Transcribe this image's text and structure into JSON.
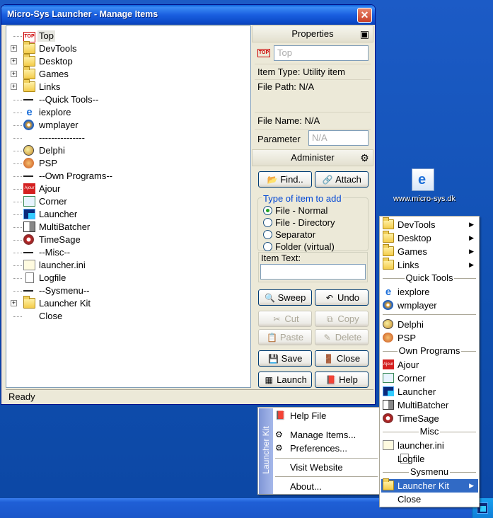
{
  "window": {
    "title": "Micro-Sys Launcher - Manage Items",
    "close_glyph": "✕",
    "status": "Ready"
  },
  "tree": [
    {
      "label": "Top",
      "icon": "top-icon",
      "expandable": false,
      "selected": true
    },
    {
      "label": "DevTools",
      "icon": "folder-icon",
      "expandable": true
    },
    {
      "label": "Desktop",
      "icon": "folder-icon",
      "expandable": true
    },
    {
      "label": "Games",
      "icon": "folder-icon",
      "expandable": true
    },
    {
      "label": "Links",
      "icon": "folder-icon",
      "expandable": true
    },
    {
      "label": "--Quick Tools--",
      "icon": "separator-icon",
      "expandable": false
    },
    {
      "label": "iexplore",
      "icon": "ie-icon",
      "expandable": false
    },
    {
      "label": "wmplayer",
      "icon": "wmplayer-icon",
      "expandable": false
    },
    {
      "label": "---------------",
      "icon": "none",
      "expandable": false
    },
    {
      "label": "Delphi",
      "icon": "delphi-icon",
      "expandable": false
    },
    {
      "label": "PSP",
      "icon": "psp-icon",
      "expandable": false
    },
    {
      "label": "--Own Programs--",
      "icon": "separator-icon",
      "expandable": false
    },
    {
      "label": "Ajour",
      "icon": "ajour-icon",
      "expandable": false
    },
    {
      "label": "Corner",
      "icon": "corner-icon",
      "expandable": false
    },
    {
      "label": "Launcher",
      "icon": "launcher-icon",
      "expandable": false
    },
    {
      "label": "MultiBatcher",
      "icon": "multibatcher-icon",
      "expandable": false
    },
    {
      "label": "TimeSage",
      "icon": "timesage-icon",
      "expandable": false
    },
    {
      "label": "--Misc--",
      "icon": "separator-icon",
      "expandable": false
    },
    {
      "label": "launcher.ini",
      "icon": "ini-file-icon",
      "expandable": false
    },
    {
      "label": "Logfile",
      "icon": "log-file-icon",
      "expandable": false
    },
    {
      "label": "--Sysmenu--",
      "icon": "separator-icon",
      "expandable": false
    },
    {
      "label": "Launcher Kit",
      "icon": "folder-icon",
      "expandable": true
    },
    {
      "label": "Close",
      "icon": "none",
      "expandable": false
    }
  ],
  "properties": {
    "header": "Properties",
    "top_icon_text": "TOP",
    "name_value": "Top",
    "item_type": "Item Type: Utility item",
    "file_path": "File Path: N/A",
    "file_name": "File Name: N/A",
    "parameter_label": "Parameter",
    "parameter_value": "N/A"
  },
  "administer": {
    "header": "Administer",
    "find": "Find..",
    "attach": "Attach",
    "group_label": "Type of item to add",
    "radios": [
      "File - Normal",
      "File - Directory",
      "Separator",
      "Folder (virtual)"
    ],
    "selected_radio": 0,
    "item_text_label": "Item Text:",
    "item_text_value": "",
    "sweep": "Sweep",
    "undo": "Undo",
    "cut": "Cut",
    "copy": "Copy",
    "paste": "Paste",
    "delete": "Delete",
    "save": "Save",
    "close": "Close",
    "launch": "Launch",
    "help": "Help"
  },
  "desktop_icon": {
    "label": "www.micro-sys.dk"
  },
  "context_menu": {
    "items": [
      {
        "label": "DevTools",
        "type": "folder"
      },
      {
        "label": "Desktop",
        "type": "folder"
      },
      {
        "label": "Games",
        "type": "folder"
      },
      {
        "label": "Links",
        "type": "folder"
      },
      {
        "label": "Quick Tools",
        "type": "sep"
      },
      {
        "label": "iexplore",
        "type": "item",
        "icon": "ie-icon"
      },
      {
        "label": "wmplayer",
        "type": "item",
        "icon": "wmplayer-icon"
      },
      {
        "label": "",
        "type": "line"
      },
      {
        "label": "Delphi",
        "type": "item",
        "icon": "delphi-icon"
      },
      {
        "label": "PSP",
        "type": "item",
        "icon": "psp-icon"
      },
      {
        "label": "Own Programs",
        "type": "sep"
      },
      {
        "label": "Ajour",
        "type": "item",
        "icon": "ajour-icon"
      },
      {
        "label": "Corner",
        "type": "item",
        "icon": "corner-icon"
      },
      {
        "label": "Launcher",
        "type": "item",
        "icon": "launcher-icon"
      },
      {
        "label": "MultiBatcher",
        "type": "item",
        "icon": "multibatcher-icon"
      },
      {
        "label": "TimeSage",
        "type": "item",
        "icon": "timesage-icon"
      },
      {
        "label": "Misc",
        "type": "sep"
      },
      {
        "label": "launcher.ini",
        "type": "item",
        "icon": "ini-file-icon"
      },
      {
        "label": "Logfile",
        "type": "item",
        "icon": "log-file-icon"
      },
      {
        "label": "Sysmenu",
        "type": "sep"
      },
      {
        "label": "Launcher Kit",
        "type": "folder",
        "highlighted": true
      },
      {
        "label": "Close",
        "type": "plain"
      }
    ]
  },
  "launcher_kit_menu": {
    "sidebar": "Launcher Kit",
    "items": [
      "Help File",
      "Manage Items...",
      "Preferences...",
      "Visit Website",
      "About..."
    ]
  },
  "colors": {
    "selection": "#316ac5",
    "desktop": "#1151b5",
    "group_label": "#0046d5"
  }
}
